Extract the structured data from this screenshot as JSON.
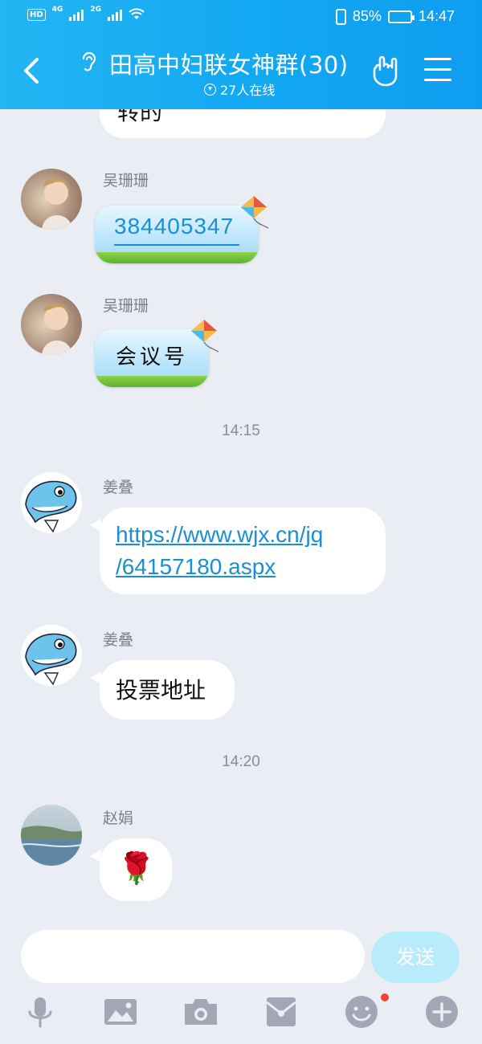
{
  "status_bar": {
    "hd_label": "HD",
    "net1": "4G",
    "net2": "2G",
    "battery_text": "85%",
    "battery_level": 0.85,
    "time": "14:47"
  },
  "header": {
    "title": "田高中妇联女神群(30)",
    "online_count": "27人在线"
  },
  "messages": {
    "partial_text": "转的",
    "m1": {
      "sender": "吴珊珊",
      "text": "384405347"
    },
    "m2": {
      "sender": "吴珊珊",
      "text": "会议号"
    },
    "time1": "14:15",
    "m3": {
      "sender": "姜叠",
      "link_line1": "https://www.wjx.cn/jq",
      "link_line2": "/64157180.aspx"
    },
    "m4": {
      "sender": "姜叠",
      "text": "投票地址"
    },
    "time2": "14:20",
    "m5": {
      "sender": "赵娟",
      "emoji": "🌹"
    }
  },
  "input": {
    "placeholder": "",
    "send_label": "发送"
  },
  "toolbar": {
    "items": [
      "mic-icon",
      "image-icon",
      "camera-icon",
      "red-packet-icon",
      "emoji-icon",
      "plus-icon"
    ]
  },
  "colors": {
    "header": "#13a9f2",
    "background": "#eaedf4",
    "link": "#1a8fd4",
    "send_button": "#b8ecfb",
    "toolbar_icon": "#a2a7b5"
  }
}
